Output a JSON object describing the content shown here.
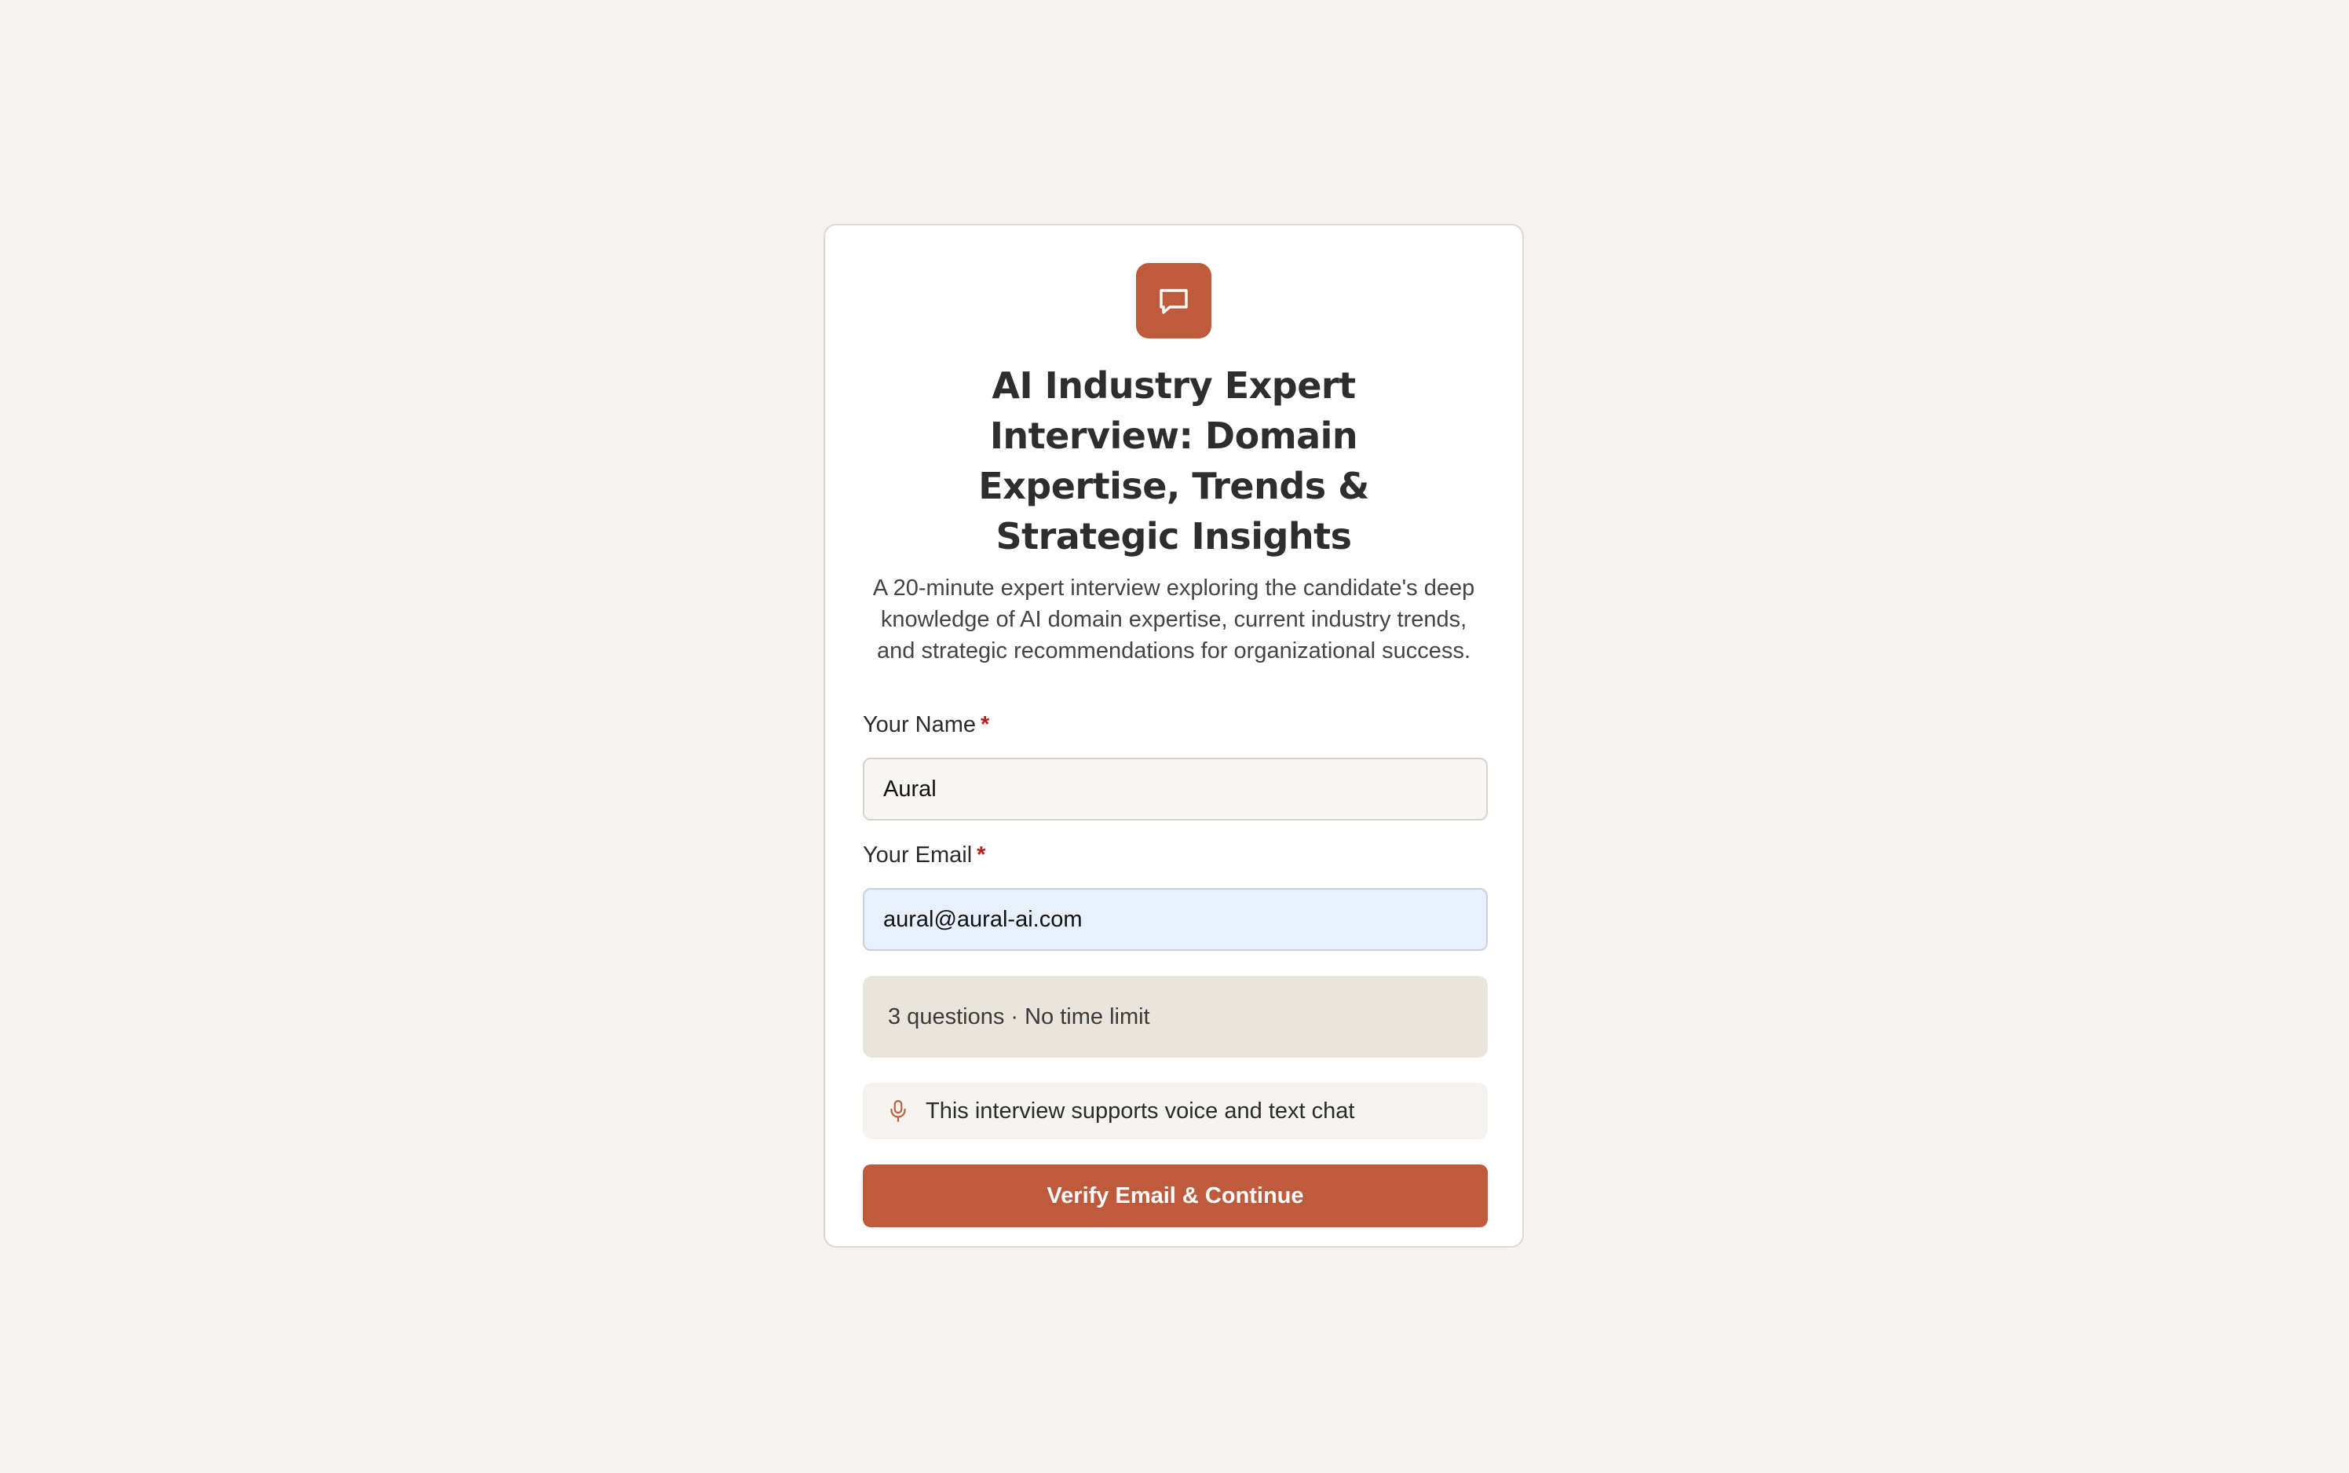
{
  "app": {
    "title": "AI Industry Expert Interview: Domain Expertise, Trends & Strategic Insights",
    "description": "A 20-minute expert interview exploring the candidate's deep knowledge of AI domain expertise, current industry trends, and strategic recommendations for organizational success."
  },
  "icons": {
    "logo": "chat-bubble-icon",
    "voice": "microphone-icon"
  },
  "form": {
    "name_label": "Your Name",
    "name_required": "*",
    "name_value": "Aural",
    "email_label": "Your Email",
    "email_required": "*",
    "email_value": "aural@aural-ai.com"
  },
  "info": {
    "summary": "3 questions · No time limit",
    "voice_notice": "This interview supports voice and text chat"
  },
  "actions": {
    "submit_label": "Verify Email & Continue"
  },
  "colors": {
    "accent": "#bf5b3d",
    "background": "#f4f3ef",
    "required": "#b91c1c",
    "email_autofill": "#e8f0fd"
  }
}
